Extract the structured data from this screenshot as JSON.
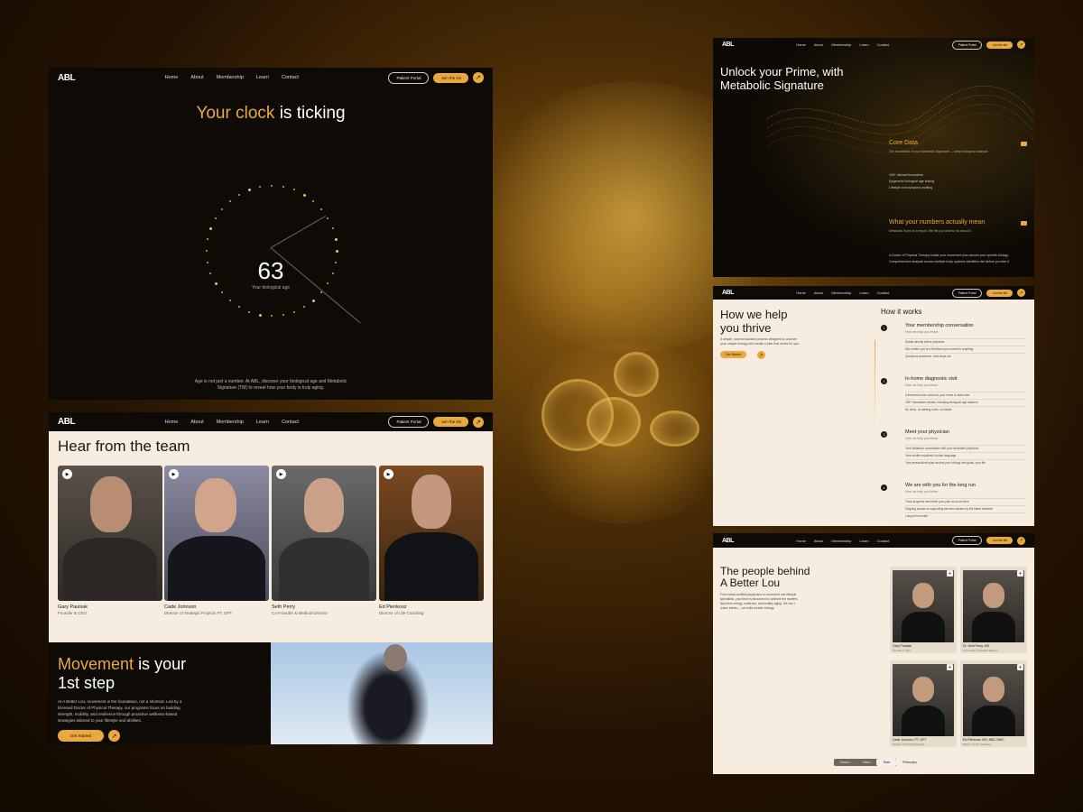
{
  "nav": {
    "logo": "ABL",
    "links": [
      "Home",
      "About",
      "Membership",
      "Learn",
      "Contact"
    ],
    "patient_portal": "Patient Portal",
    "join": "Join the list"
  },
  "hero": {
    "title_gold": "Your clock",
    "title_rest": "is ticking",
    "age": "63",
    "age_label": "Your biological age",
    "footer": "Age is not just a number. At ABL, discover your biological age and Metabolic Signature (TM) to reveal how your body is truly aging."
  },
  "team": {
    "heading": "Hear from the team",
    "members": [
      {
        "name": "Gary Paulsak",
        "role": "Founder & CEO"
      },
      {
        "name": "Cade Johnson",
        "role": "Director of Strategic Projects PT, DPT"
      },
      {
        "name": "Seth Perry",
        "role": "Co-Founder & Medical Director"
      },
      {
        "name": "Ed Pienkosz",
        "role": "Director of Life Coaching"
      }
    ]
  },
  "movement": {
    "title_gold": "Movement",
    "title_rest": "is your",
    "title_line2": "1st step",
    "body": "At A Better Lou, movement is the foundation, not a shortcut. Led by a licensed Doctor of Physical Therapy, our programs focus on building strength, mobility, and resilience through proactive wellness-based strategies tailored to your lifestyle and abilities.",
    "cta": "Get Started"
  },
  "signature": {
    "title_line1": "Unlock your Prime, with",
    "title_line2": "Metabolic Signature",
    "core_title": "Core Data",
    "core_sub": "The foundation of your Metabolic Signature — deep biological analysis",
    "core_items": [
      "150+ clinical biomarkers",
      "Epigenetic biological age testing",
      "Lifestyle and symptom profiling"
    ],
    "numbers_title": "What your numbers actually mean",
    "numbers_sub": "Metabolic Score is a report. We tell you what to do about it.",
    "numbers_items": [
      "A Doctor of Physical Therapy builds your movement plan around your specific biology",
      "Comprehensive analysis across multiple body systems identifies risk before you feel it"
    ]
  },
  "how": {
    "title_line1": "How we help",
    "title_line2": "you thrive",
    "body": "A simple, science-backed process designed to uncover your unique biology and create a plan that works for you.",
    "cta": "Get Started",
    "heading": "How it works",
    "steps": [
      {
        "n": "1",
        "title": "Your membership conversation",
        "sub": "How we help you thrive",
        "items": [
          "Speak directly with a physician",
          "We confirm you're a fit before you commit to anything",
          "Questions answered, next steps set"
        ]
      },
      {
        "n": "2",
        "title": "In-home diagnostic visit",
        "sub": "How we help you thrive",
        "items": [
          "A licensed nurse comes to your home to draw labs",
          "150+ biomarkers tested, including biological age markers",
          "No clinic, no waiting room, no hassle"
        ]
      },
      {
        "n": "3",
        "title": "Meet your physician",
        "sub": "How we help you thrive",
        "items": [
          "Your Metabolic consultation with your dedicated physician",
          "Your results explained in plain language",
          "Your personalized plan around your biology and goals, your life"
        ]
      },
      {
        "n": "4",
        "title": "We are with you for the long run",
        "sub": "How we help you thrive",
        "items": [
          "Track progress and refine your plan as you evolve",
          "Ongoing access to supporting services backed by the latest research",
          "Long-term results"
        ]
      }
    ]
  },
  "people": {
    "title_line1": "The people behind",
    "title_line2": "A Better Lou",
    "body": "From board-certified physicians to movement and lifestyle specialists, your team is structured to optimize the systems that drive energy, resilience, and healthy aging. We don't chase trends — we build durable biology.",
    "cards": [
      {
        "name": "Gary Paulsak",
        "role": "Founder & CEO"
      },
      {
        "name": "Dr. Seth Perry, MD",
        "role": "Co-Founder & Medical Director"
      },
      {
        "name": "Cade Johnson, PT, DPT",
        "role": "Director of Strategic Projects"
      },
      {
        "name": "Ed Pienkosz, MS, NBC-HWC",
        "role": "Director of Life Coaching"
      }
    ],
    "tabs": [
      "Mission",
      "Vision",
      "Team",
      "Philosophy"
    ]
  },
  "colors": {
    "gold": "#e9a93f",
    "dark": "#0e0b06",
    "cream": "#f7ece0"
  }
}
